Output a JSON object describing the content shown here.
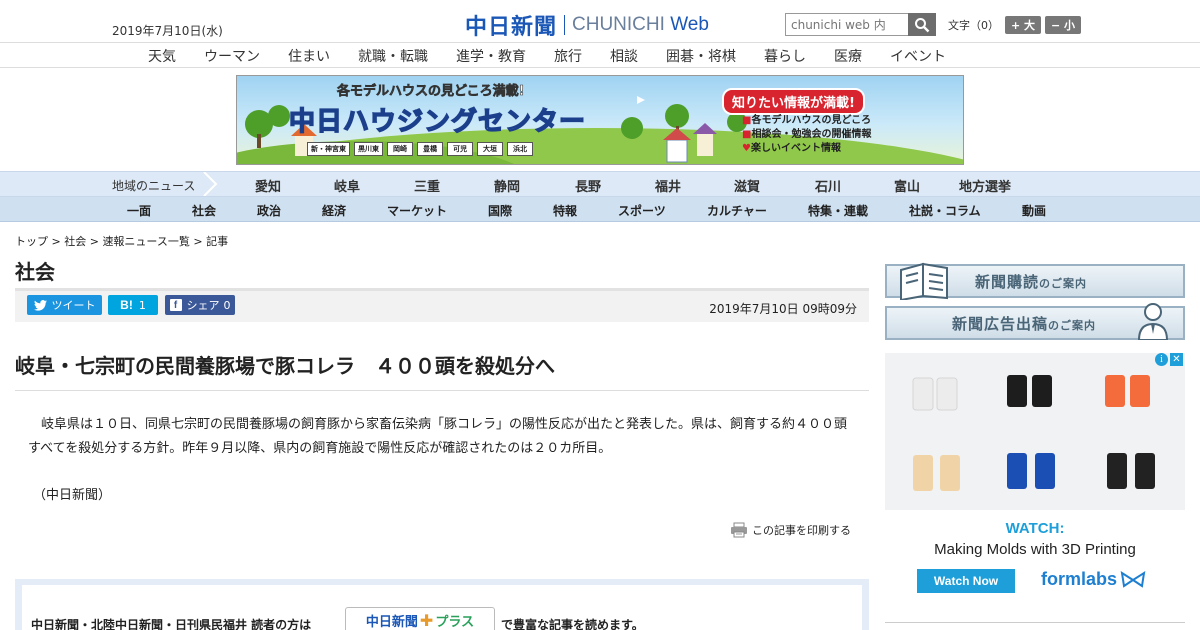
{
  "header": {
    "date": "2019年7月10日(水)",
    "logo_jp": "中日新聞",
    "logo_en_a": "CHUNICHI",
    "logo_en_b": "Web",
    "search_placeholder": "chunichi web 内",
    "fontsize_label": "文字（0）",
    "fontsize_up": "+ 大",
    "fontsize_down": "− 小"
  },
  "category_nav": [
    "天気",
    "ウーマン",
    "住まい",
    "就職・転職",
    "進学・教育",
    "旅行",
    "相談",
    "囲碁・将棋",
    "暮らし",
    "医療",
    "イベント"
  ],
  "banner": {
    "top_text": "各モデルハウスの見どころ満載!",
    "title": "中日ハウジングセンター",
    "locations": [
      "新・神宮東",
      "黒川東",
      "岡崎",
      "豊橋",
      "可児",
      "大垣",
      "浜北"
    ],
    "right_title": "知りたい情報が満載!",
    "right_items": [
      "各モデルハウスの見どころ",
      "相談会・勉強会の開催情報",
      "楽しいイベント情報"
    ]
  },
  "region_nav": {
    "label": "地域のニュース",
    "items": [
      "愛知",
      "岐阜",
      "三重",
      "静岡",
      "長野",
      "福井",
      "滋賀",
      "石川",
      "富山",
      "地方選挙"
    ]
  },
  "section_nav": [
    "一面",
    "社会",
    "政治",
    "経済",
    "マーケット",
    "国際",
    "特報",
    "スポーツ",
    "カルチャー",
    "特集・連載",
    "社説・コラム",
    "動画"
  ],
  "breadcrumb": {
    "items": [
      "トップ",
      "社会",
      "速報ニュース一覧"
    ],
    "current": "記事",
    "sep": " > "
  },
  "section_title": "社会",
  "share": {
    "tweet": "ツイート",
    "hatena_count": "1",
    "facebook": "シェア",
    "facebook_count": "0",
    "published": "2019年7月10日 09時09分"
  },
  "article": {
    "headline": "岐阜・七宗町の民間養豚場で豚コレラ　４００頭を殺処分へ",
    "body": "岐阜県は１０日、同県七宗町の民間養豚場の飼育豚から家畜伝染病「豚コレラ」の陽性反応が出たと発表した。県は、飼育する約４００頭すべてを殺処分する方針。昨年９月以降、県内の飼育施設で陽性反応が確認されたのは２０カ所目。",
    "credit": "（中日新聞）",
    "print_label": "この記事を印刷する"
  },
  "plus_promo": {
    "text1": "中日新聞・北陸中日新聞・日刊県民福井 読者の方は",
    "logo": "中日新聞",
    "logo_plus": "プラス",
    "text2": "で豊富な記事を読めます。"
  },
  "sidebar": {
    "subscribe": "新聞購読",
    "subscribe_small": "のご案内",
    "ad_placement": "新聞広告出稿",
    "ad_placement_small": "のご案内",
    "ad": {
      "watch": "WATCH:",
      "sub": "Making Molds with 3D Printing",
      "cta": "Watch Now",
      "brand": "formlabs"
    }
  },
  "colors": {
    "brand_blue": "#1a57b6",
    "twitter": "#1b95e0",
    "hatena": "#00a4de",
    "facebook": "#3b5998",
    "ad_blue": "#1e9fd9"
  }
}
